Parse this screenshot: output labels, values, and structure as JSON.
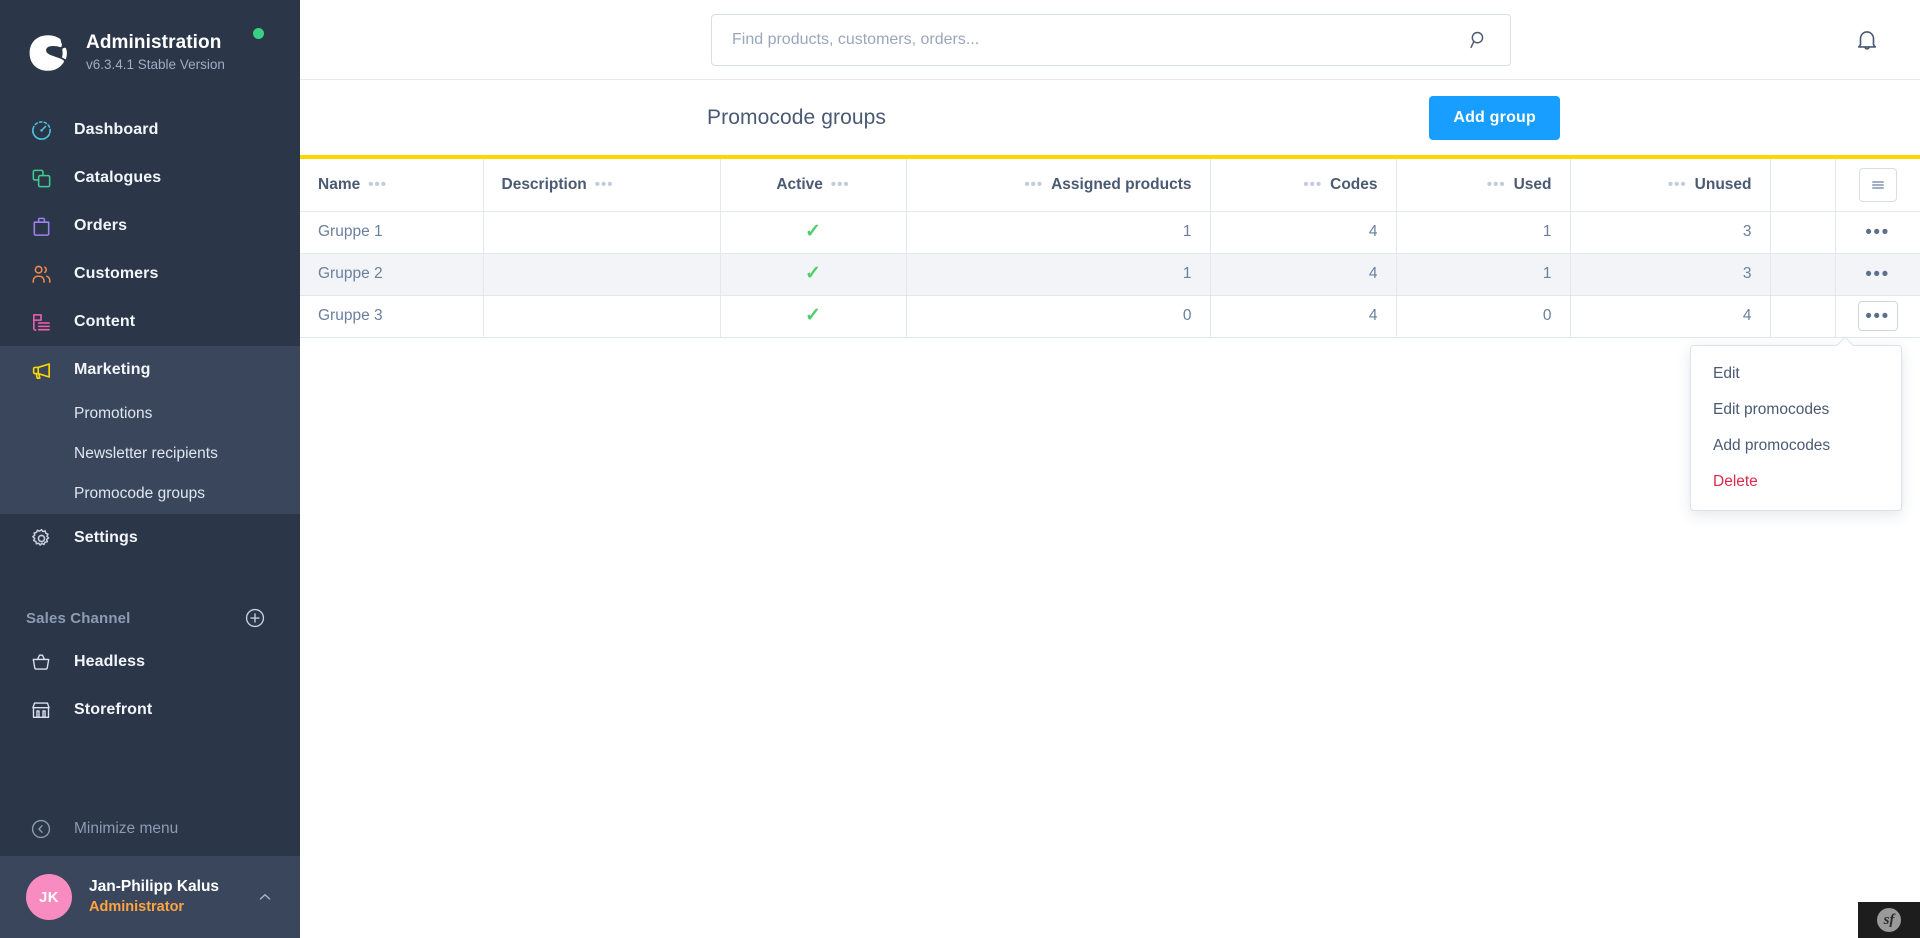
{
  "sidebar": {
    "brand": {
      "title": "Administration",
      "version": "v6.3.4.1 Stable Version",
      "logo_icon": "shopware-logo",
      "status_icon": "status-dot-online"
    },
    "items": [
      {
        "label": "Dashboard",
        "icon": "dashboard-icon",
        "color": "#4dc3e0",
        "active": false
      },
      {
        "label": "Catalogues",
        "icon": "catalogues-icon",
        "color": "#3ecf8e",
        "active": false
      },
      {
        "label": "Orders",
        "icon": "orders-icon",
        "color": "#a080f0",
        "active": false
      },
      {
        "label": "Customers",
        "icon": "customers-icon",
        "color": "#f08a4b",
        "active": false
      },
      {
        "label": "Content",
        "icon": "content-icon",
        "color": "#f261b4",
        "active": false
      },
      {
        "label": "Marketing",
        "icon": "marketing-megaphone-icon",
        "color": "#ffd700",
        "active": true
      },
      {
        "label": "Settings",
        "icon": "gear-icon",
        "color": "#c6cfdb",
        "active": false
      }
    ],
    "marketing_subitems": [
      {
        "label": "Promotions",
        "active": false
      },
      {
        "label": "Newsletter recipients",
        "active": false
      },
      {
        "label": "Promocode groups",
        "active": true
      }
    ],
    "sales_channel": {
      "label": "Sales Channel",
      "add_icon": "plus-circle-icon",
      "items": [
        {
          "label": "Headless",
          "icon": "basket-icon"
        },
        {
          "label": "Storefront",
          "icon": "shop-icon"
        }
      ]
    },
    "minimize": {
      "label": "Minimize menu",
      "icon": "chevron-left-circle-icon"
    },
    "user": {
      "initials": "JK",
      "name": "Jan-Philipp Kalus",
      "role": "Administrator",
      "caret_icon": "chevron-up-icon"
    }
  },
  "topbar": {
    "search": {
      "placeholder": "Find products, customers, orders...",
      "value": "",
      "icon": "search-icon"
    },
    "notifications_icon": "bell-icon"
  },
  "page": {
    "title": "Promocode groups",
    "add_button": "Add group",
    "accent_color": "#ffd700"
  },
  "table": {
    "settings_icon": "grid-settings-icon",
    "row_menu_icon": "kebab-menu-icon",
    "columns": [
      {
        "label": "Name",
        "align": "left"
      },
      {
        "label": "Description",
        "align": "left"
      },
      {
        "label": "Active",
        "align": "center"
      },
      {
        "label": "Assigned products",
        "align": "right"
      },
      {
        "label": "Codes",
        "align": "right"
      },
      {
        "label": "Used",
        "align": "right"
      },
      {
        "label": "Unused",
        "align": "right"
      }
    ],
    "rows": [
      {
        "name": "Gruppe 1",
        "description": "",
        "active": true,
        "assigned_products": "1",
        "codes": "4",
        "used": "1",
        "unused": "3"
      },
      {
        "name": "Gruppe 2",
        "description": "",
        "active": true,
        "assigned_products": "1",
        "codes": "4",
        "used": "1",
        "unused": "3"
      },
      {
        "name": "Gruppe 3",
        "description": "",
        "active": true,
        "assigned_products": "0",
        "codes": "4",
        "used": "0",
        "unused": "4"
      }
    ],
    "active_check_glyph": "✓",
    "active_check_color": "#4ecf6a"
  },
  "context_menu": {
    "open_for_row": "Gruppe 3",
    "items": [
      {
        "label": "Edit",
        "danger": false
      },
      {
        "label": "Edit promocodes",
        "danger": false
      },
      {
        "label": "Add promocodes",
        "danger": false
      },
      {
        "label": "Delete",
        "danger": true
      }
    ]
  },
  "debug_toolbar": {
    "icon": "symfony-profiler-icon",
    "glyph": "sf"
  }
}
